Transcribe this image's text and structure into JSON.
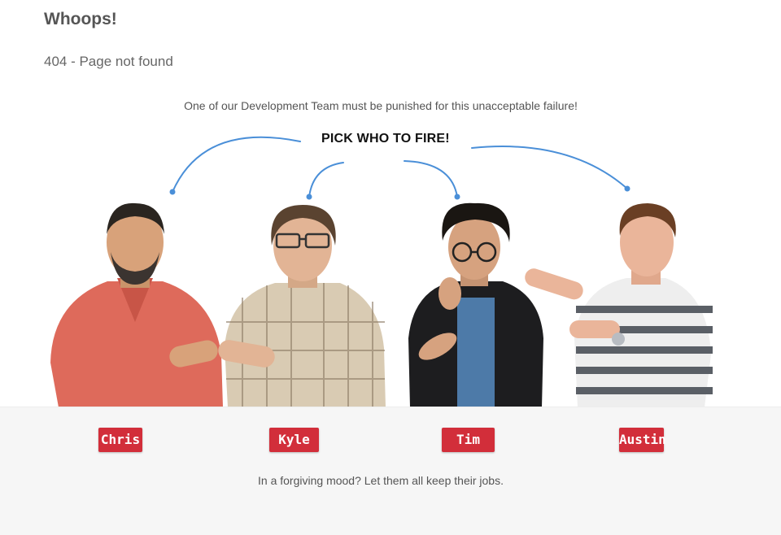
{
  "page": {
    "title": "Whoops!",
    "subtitle": "404 - Page not found",
    "message": "One of our Development Team must be punished for this unacceptable failure!",
    "pick_label": "PICK WHO TO FIRE!",
    "forgive_text": "In a forgiving mood? Let them all keep their jobs."
  },
  "team": [
    {
      "name": "Chris",
      "shirt": "red polo"
    },
    {
      "name": "Kyle",
      "shirt": "plaid shirt"
    },
    {
      "name": "Tim",
      "shirt": "black jacket"
    },
    {
      "name": "Austin",
      "shirt": "striped polo"
    }
  ],
  "colors": {
    "button": "#d22e3a",
    "arc": "#4a8fd8",
    "band": "#f6f6f6"
  }
}
